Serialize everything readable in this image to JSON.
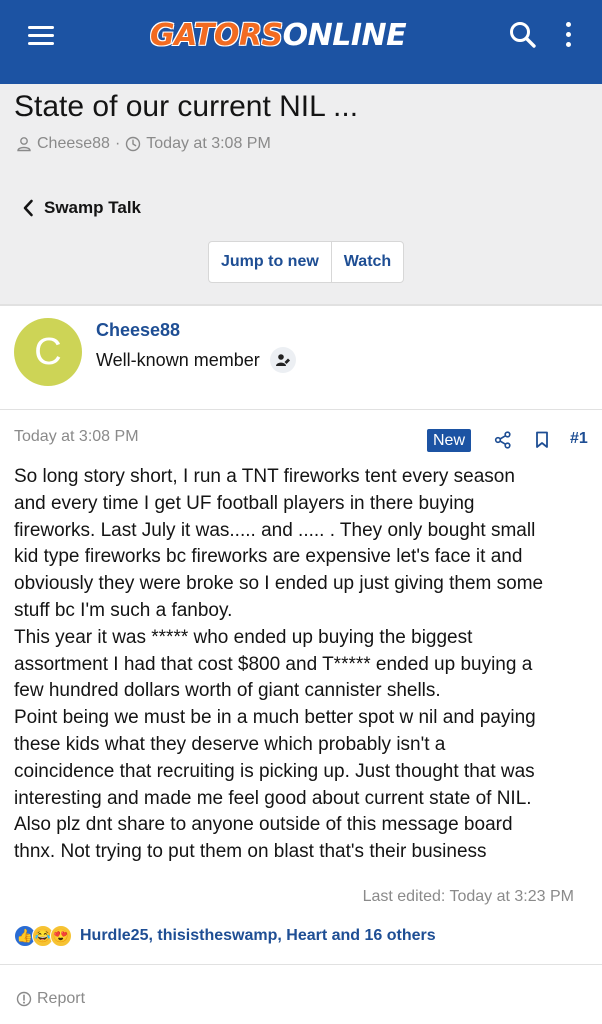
{
  "topbar": {
    "logo_part1": "GATORS",
    "logo_part2": "ONLINE",
    "bg_color": "#1c53a3",
    "accent_color": "#f26b21",
    "icons": [
      "menu-icon",
      "search-icon",
      "more-vertical-icon"
    ]
  },
  "thread": {
    "title": "State of our current NIL ...",
    "author": "Cheese88",
    "separator": "·",
    "date": "Today at 3:08 PM",
    "back_label": "Swamp Talk",
    "jump_label": "Jump to new",
    "watch_label": "Watch"
  },
  "post": {
    "avatar_letter": "C",
    "avatar_color": "#cdd456",
    "username": "Cheese88",
    "user_title": "Well-known member",
    "date": "Today at 3:08 PM",
    "new_badge": "New",
    "post_number": "#1",
    "body_lines": [
      "So long story short, I run a TNT fireworks tent every season",
      "and every time I get UF football players in there buying",
      "fireworks. Last July it was..... and ..... . They only bought small",
      "kid type fireworks bc fireworks are expensive let's face it and",
      "obviously they were broke so I ended up just giving them some",
      "stuff bc I'm such a fanboy.",
      "This year it was ***** who ended up buying the biggest",
      "assortment I had that cost $800 and T***** ended up buying a",
      "few hundred dollars worth of giant cannister shells.",
      "Point being we must be in a much better spot w nil and paying",
      "these kids what they deserve which probably isn't a",
      "coincidence that recruiting is picking up. Just thought that was",
      "interesting and made me feel good about current state of NIL.",
      "Also plz dnt share to anyone outside of this message board",
      "thnx. Not trying to put them on blast that's their business"
    ],
    "last_edited": "Last edited: Today at 3:23 PM",
    "reaction_icons": [
      "like-reaction-icon",
      "haha-reaction-icon",
      "love-reaction-icon"
    ],
    "reaction_users": "Hurdle25, thisistheswamp, Heart and 16 others",
    "report_label": "Report"
  }
}
